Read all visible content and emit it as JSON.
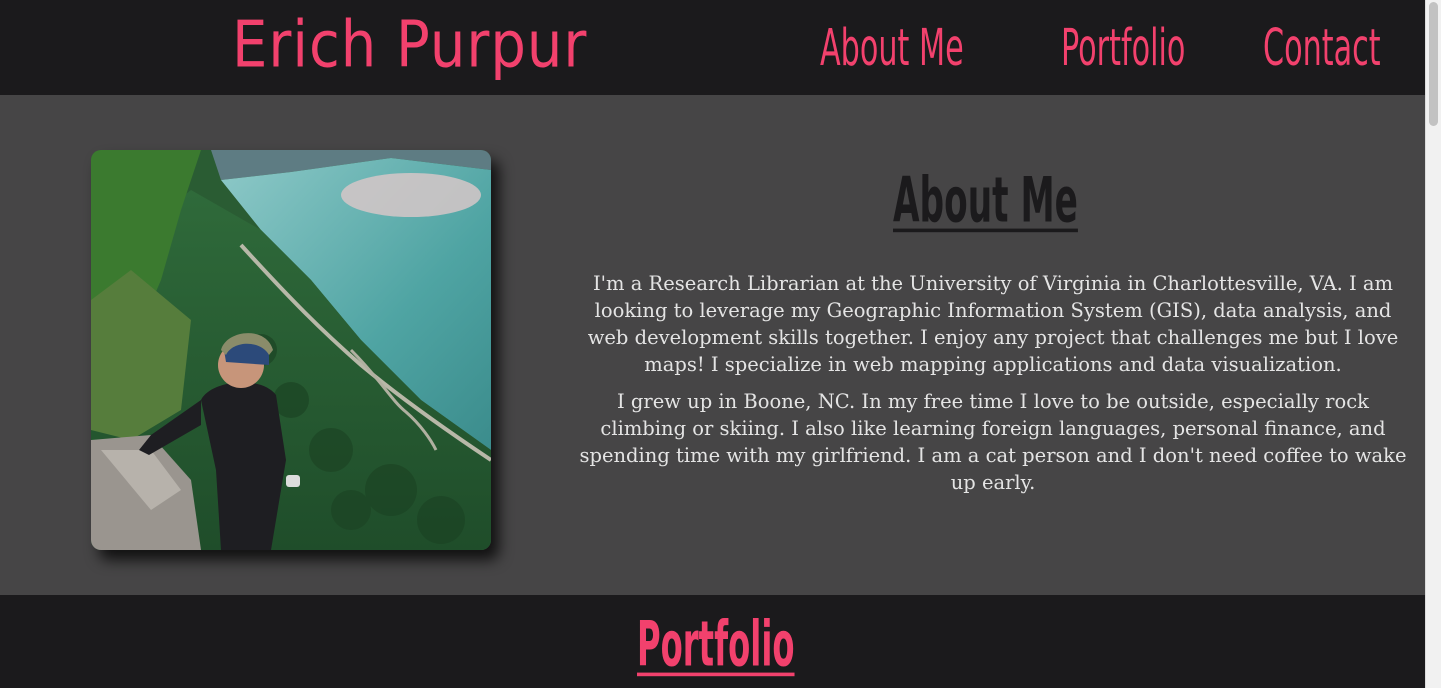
{
  "header": {
    "brand": "Erich Purpur",
    "nav": [
      {
        "label": "About Me"
      },
      {
        "label": "Portfolio"
      },
      {
        "label": "Contact"
      }
    ]
  },
  "about": {
    "title": "About Me",
    "paragraphs": [
      "I'm a Research Librarian at the University of Virginia in Charlottesville, VA. I am looking to leverage my Geographic Information System (GIS), data analysis, and web development skills together. I enjoy any project that challenges me but I love maps! I specialize in web mapping applications and data visualization.",
      "I grew up in Boone, NC. In my free time I love to be outside, especially rock climbing or skiing. I also like learning foreign languages, personal finance, and spending time with my girlfriend. I am a cat person and I don't need coffee to wake up early."
    ]
  },
  "portfolio": {
    "title": "Portfolio"
  },
  "colors": {
    "accent": "#f2416d",
    "header_bg": "#1b1a1c",
    "section_bg": "#464546",
    "body_text": "#e4e4e4"
  }
}
